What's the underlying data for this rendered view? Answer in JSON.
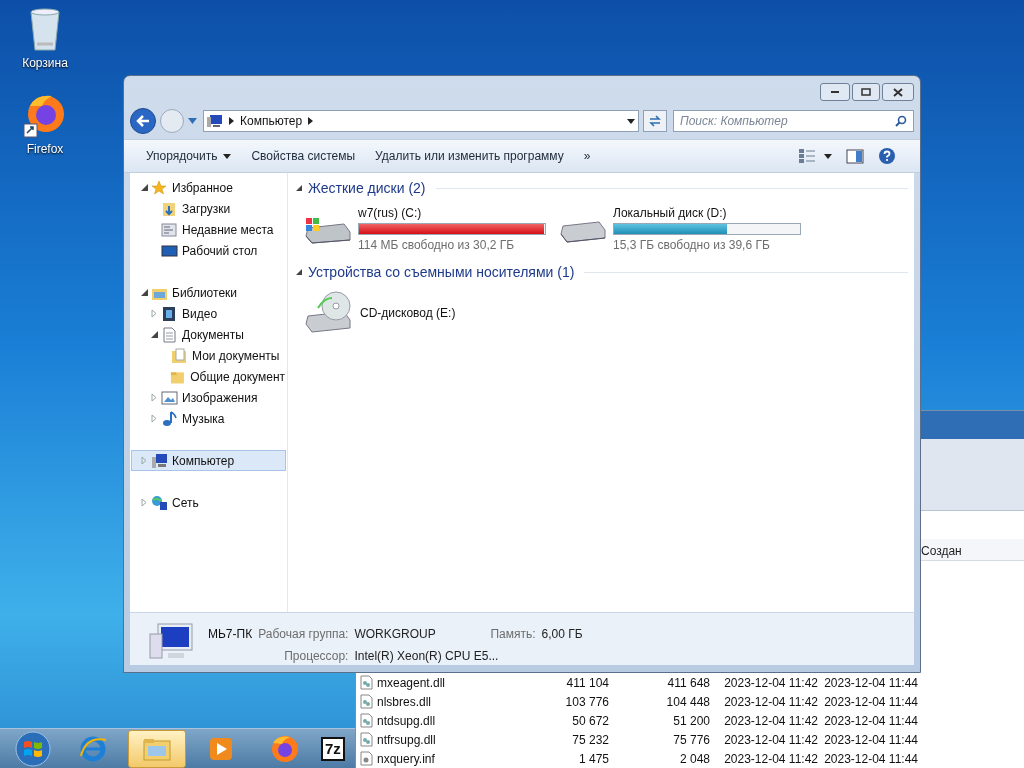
{
  "desktop_icons": [
    {
      "kind": "recycle",
      "label": "Корзина"
    },
    {
      "kind": "firefox",
      "label": "Firefox"
    }
  ],
  "background_window": {
    "column_header": "Создан",
    "rows": [
      {
        "kind": "dll",
        "cells": [
          "mxeagent.dll",
          "411 104",
          "411 648",
          "2023-12-04 11:42",
          "2023-12-04 11:44"
        ]
      },
      {
        "kind": "dll",
        "cells": [
          "nlsbres.dll",
          "103 776",
          "104 448",
          "2023-12-04 11:42",
          "2023-12-04 11:44"
        ]
      },
      {
        "kind": "dll",
        "cells": [
          "ntdsupg.dll",
          "50 672",
          "51 200",
          "2023-12-04 11:42",
          "2023-12-04 11:44"
        ]
      },
      {
        "kind": "dll",
        "cells": [
          "ntfrsupg.dll",
          "75 232",
          "75 776",
          "2023-12-04 11:42",
          "2023-12-04 11:44"
        ]
      },
      {
        "kind": "inf",
        "cells": [
          "nxquery.inf",
          "1 475",
          "2 048",
          "2023-12-04 11:42",
          "2023-12-04 11:44"
        ]
      }
    ]
  },
  "explorer": {
    "address": {
      "crumbs": [
        "Компьютер"
      ]
    },
    "search": {
      "placeholder": "Поиск: Компьютер"
    },
    "toolbar": [
      {
        "label": "Упорядочить",
        "dropdown": true
      },
      {
        "label": "Свойства системы",
        "dropdown": false
      },
      {
        "label": "Удалить или изменить программу",
        "dropdown": false
      },
      {
        "label": "»",
        "dropdown": false
      }
    ],
    "nav": [
      {
        "label": "Избранное",
        "expanded": true,
        "selected": false,
        "children": [
          {
            "label": "Загрузки",
            "selected": false
          },
          {
            "label": "Недавние места",
            "selected": false
          },
          {
            "label": "Рабочий стол",
            "selected": false
          }
        ]
      },
      {
        "label": "Библиотеки",
        "expanded": true,
        "selected": false,
        "children": [
          {
            "label": "Видео",
            "expanded": false,
            "selected": false
          },
          {
            "label": "Документы",
            "expanded": true,
            "selected": false,
            "children": [
              {
                "label": "Мои документы",
                "selected": false
              },
              {
                "label": "Общие документ",
                "selected": false
              }
            ]
          },
          {
            "label": "Изображения",
            "expanded": false,
            "selected": false
          },
          {
            "label": "Музыка",
            "expanded": false,
            "selected": false
          }
        ]
      },
      {
        "label": "Компьютер",
        "expanded": false,
        "selected": true
      },
      {
        "label": "Сеть",
        "expanded": false,
        "selected": false
      }
    ],
    "groups": [
      {
        "title": "Жесткие диски (2)",
        "expanded": true,
        "items": [
          {
            "kind": "hdd-windows",
            "name": "w7(rus) (C:)",
            "level": 0.996,
            "critical": true,
            "free": "114 МБ свободно из 30,2 ГБ"
          },
          {
            "kind": "hdd",
            "name": "Локальный диск (D:)",
            "level": 0.61,
            "critical": false,
            "free": "15,3 ГБ свободно из 39,6 ГБ"
          }
        ]
      },
      {
        "title": "Устройства со съемными носителями (1)",
        "expanded": true,
        "items": [
          {
            "kind": "cd",
            "name": "CD-дисковод (E:)"
          }
        ]
      }
    ],
    "details": {
      "name": "МЬ7-ПК",
      "workgroup_label": "Рабочая группа:",
      "workgroup": "WORKGROUP",
      "memory_label": "Память:",
      "memory": "6,00 ГБ",
      "cpu_label": "Процессор:",
      "cpu": "Intel(R) Xeon(R) CPU E5..."
    }
  },
  "taskbar": [
    {
      "kind": "start",
      "selected": false
    },
    {
      "kind": "ie",
      "selected": false
    },
    {
      "kind": "explorer",
      "selected": true
    },
    {
      "kind": "media",
      "selected": false
    },
    {
      "kind": "firefox",
      "selected": false
    },
    {
      "kind": "archive",
      "label": "7z",
      "selected": false
    }
  ]
}
